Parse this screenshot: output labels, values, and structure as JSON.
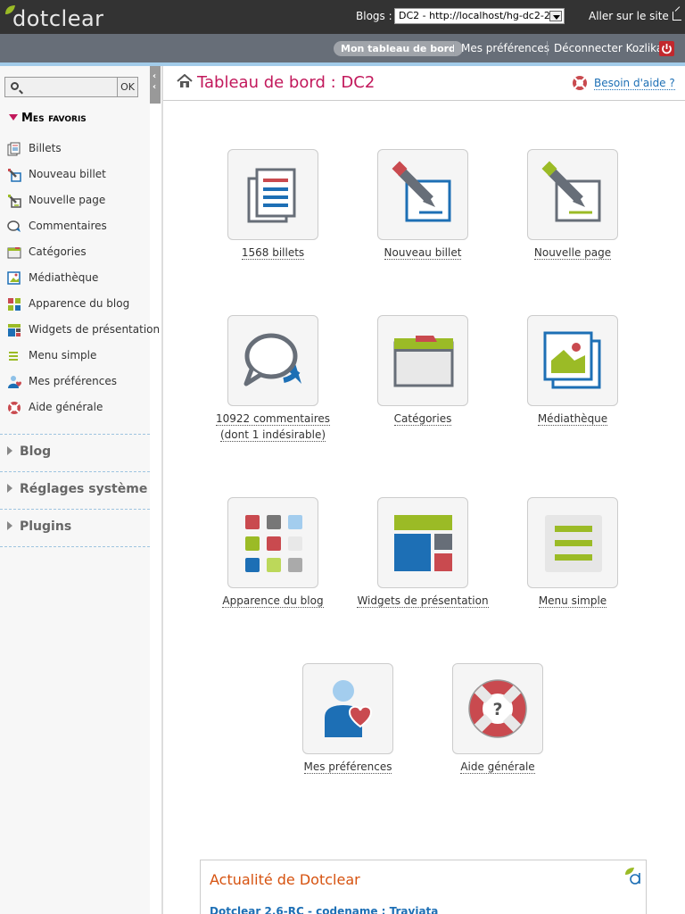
{
  "topbar": {
    "logo_text": "dotclear",
    "blogs_label": "Blogs :",
    "blog_selected": "DC2 - http://localhost/hg-dc2-2",
    "goto_site": "Aller sur le site"
  },
  "userbar": {
    "dashboard": "Mon tableau de bord",
    "preferences": "Mes préférences",
    "logout": "Déconnecter Kozlika"
  },
  "search": {
    "placeholder": "",
    "ok": "OK"
  },
  "favorites": {
    "heading": "Mes favoris",
    "items": [
      {
        "label": "Billets",
        "icon": "posts-icon"
      },
      {
        "label": "Nouveau billet",
        "icon": "new-post-icon"
      },
      {
        "label": "Nouvelle page",
        "icon": "new-page-icon"
      },
      {
        "label": "Commentaires",
        "icon": "comments-icon"
      },
      {
        "label": "Catégories",
        "icon": "categories-icon"
      },
      {
        "label": "Médiathèque",
        "icon": "media-icon"
      },
      {
        "label": "Apparence du blog",
        "icon": "theme-icon"
      },
      {
        "label": "Widgets de présentation",
        "icon": "widgets-icon"
      },
      {
        "label": "Menu simple",
        "icon": "menu-icon"
      },
      {
        "label": "Mes préférences",
        "icon": "preferences-icon"
      },
      {
        "label": "Aide générale",
        "icon": "help-icon"
      }
    ]
  },
  "sections": [
    "Blog",
    "Réglages système",
    "Plugins"
  ],
  "main": {
    "title": "Tableau de bord : DC2",
    "help": "Besoin d'aide ?",
    "tiles": [
      {
        "label": "1568 billets",
        "label2": ""
      },
      {
        "label": "Nouveau billet",
        "label2": ""
      },
      {
        "label": "Nouvelle page",
        "label2": ""
      },
      {
        "label": "10922 commentaires",
        "label2": "(dont 1 indésirable)"
      },
      {
        "label": "Catégories",
        "label2": ""
      },
      {
        "label": "Médiathèque",
        "label2": ""
      },
      {
        "label": "Apparence du blog",
        "label2": ""
      },
      {
        "label": "Widgets de présentation",
        "label2": ""
      },
      {
        "label": "Menu simple",
        "label2": ""
      },
      {
        "label": "Mes préférences",
        "label2": ""
      },
      {
        "label": "Aide générale",
        "label2": ""
      }
    ]
  },
  "news": {
    "title": "Actualité de Dotclear",
    "first_item": "Dotclear 2.6-RC - codename : Traviata"
  },
  "colors": {
    "accent": "#c2185b",
    "blue": "#1d6fb5",
    "green": "#9bbb26",
    "red": "#c94a4f",
    "gray": "#676e78"
  }
}
